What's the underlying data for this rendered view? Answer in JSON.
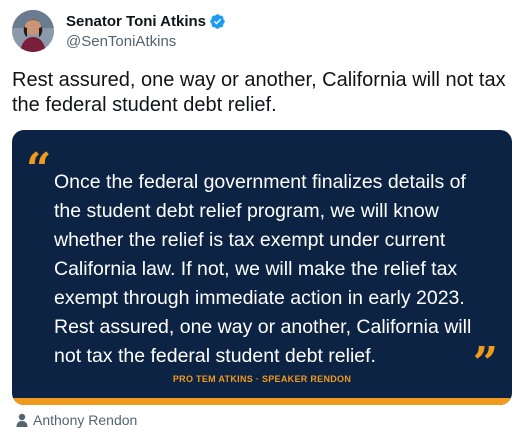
{
  "author": {
    "display_name": "Senator Toni Atkins",
    "handle": "@SenToniAtkins",
    "verified_icon": "verified-badge-icon",
    "avatar_icon": "avatar-icon"
  },
  "tweet": {
    "text": "Rest assured, one way or another, California will not tax the federal student debt relief."
  },
  "media": {
    "quote": "Once the federal government finalizes details of the student debt relief program, we will know whether the relief is tax exempt under current California law. If not, we will make the relief tax exempt through immediate action in early 2023. Rest assured, one way or another, California will not tax the federal student debt relief.",
    "open_quote_mark": "“",
    "close_quote_mark": "”",
    "credit": "PRO TEM ATKINS · SPEAKER RENDON",
    "background_color": "#0c2344",
    "accent_color": "#f09a1e"
  },
  "tagged": {
    "icon": "person-icon",
    "name": "Anthony Rendon"
  }
}
